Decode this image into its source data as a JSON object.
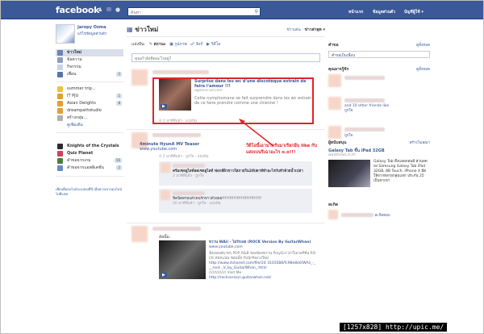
{
  "topbar": {
    "logo": "facebook",
    "search_placeholder": "ค้นหา",
    "home": "หน้าแรก",
    "profile": "ข้อมูลส่วนตัว",
    "account": "บัญชีผู้ใช้ ▾"
  },
  "profile": {
    "name": "Jaropy Ozma",
    "edit": "แก้ไขข้อมูลส่วนตัว"
  },
  "sidebar": {
    "items": [
      {
        "label": "ข่าวใหม่",
        "count": ""
      },
      {
        "label": "ข้อความ",
        "count": ""
      },
      {
        "label": "กิจกรรม",
        "count": ""
      },
      {
        "label": "เพื่อน",
        "count": "2"
      }
    ],
    "apps": [
      {
        "label": "summer trip...",
        "count": ""
      },
      {
        "label": "IT PJU",
        "count": "1"
      },
      {
        "label": "Asian Delights",
        "count": "8"
      },
      {
        "label": "dreampathstudio",
        "count": ""
      },
      {
        "label": "สร้างกลุ่ม...",
        "count": ""
      },
      {
        "label": "ดูเพิ่มเติม",
        "count": ""
      }
    ],
    "games": [
      {
        "label": "Knights of the Crystals",
        "count": ""
      },
      {
        "label": "Quiz Planet",
        "count": ""
      },
      {
        "label": "คำขอจากเกม",
        "count": "56"
      },
      {
        "label": "คำขอจากแอพลิเคชั่น",
        "count": "2"
      }
    ],
    "note": "เพื่อนที่ออนไลน์จะแสดงที่นี่ เมื่อพวกเขาออนไลน์ ไปที่แชท"
  },
  "feed": {
    "title": "ข่าวใหม่",
    "sort_top": "ข่าวเด่น",
    "sort_recent": "ข่าวล่าสุด ▾",
    "share_label": "แบ่งปัน:",
    "share_status": "สถานะ",
    "share_photo": "รูปภาพ",
    "share_link": "ลิงก์",
    "share_video": "วิดีโอ",
    "status_placeholder": "คุณกำลังคิดอะไรอยู่?",
    "post1": {
      "link_title": "Surprise dans les wc d'une discotèque estrain de faire l'amour !!!",
      "domain": "agence-ad.com",
      "desc": "Cette nymphomane se fait surprendre dans les wc estrain de ce faire prendre comme une chienne !",
      "meta": "2 นาทีที่แล้ว · แบ่งปัน"
    },
    "post2": {
      "title": "4minute HyunA MV Teaser",
      "domain": "www.youtube.com",
      "meta": "2 นาทีที่แล้ว · ถูกใจ · แบ่งปัน",
      "comment1": "ครีมเซลลูไลท์ลดเซลลูไลท์ ฟอกสีผิวขาวใสภายใน2สัปดาห์ทำอะไรกับทำด้วยน้ำเปล่า",
      "comment1_meta": "2 นาทีที่แล้ว · ถูกใจ",
      "comment2": "ฟิตนิตตรอบตัวคนรักข่าวด้วยยย!!!!!!!!!!!!!!!!!!!!!!!!!!!",
      "comment2_meta": "20 นาทีที่แล้ว · ถูกใจ · แบ่งปัน"
    },
    "post3": {
      "label": "อัลบั้ม:",
      "title": "หวาน WAii - ไม่รักเลย (ROCK Version By GuitarWhan)",
      "domain": "www.youtube.com",
      "desc": "ฟังเพลงสบายๆ POP R&B ของน้องหวาน PlayGirl มาในเวอร์ชั่น ROCK หนักแน่น ชอบมั้ย กับนักร้องวงใหม่",
      "link1": "http://www.4shared.com/file/24 3103588/fc98e8e0/WAii_-___rock _V_by_GuitarWhan_.html",
      "slashes": "////////////// Visit Me",
      "link2": "http://rockversion.guitarwhan.net/"
    }
  },
  "right": {
    "requests": "คำขอ",
    "requests_link": "ดูทั้งหมด",
    "request_text": "คำขอเป็นเพื่อน",
    "suggest_title": "คุณอาจรู้จัก",
    "suggest_link": "ดูทั้งหมด",
    "add_friend": "เพิ่มเป็นเพื่อน",
    "and_others": "and 10 other friends like",
    "like": "ถูกใจ",
    "sponsored": "ผู้สนับสนุน",
    "sponsored_link": "สร้างโฆษณา",
    "ad_title": "Galaxy Tab ขึ้น iPad 32GB",
    "ad_domain": "wallstreet.in.th",
    "ad_text": "Galaxy Tab ดึงแอพถอนมี ส่วนลดลง Samsung Galaxy Tab iPad 32GB, 8B Touch, iPhone 4 มีดให้จากหลายกลุ่มแจก ประกัน 25 เป็นขาเขา",
    "chat": "สะกิด",
    "chat_link": "สะกิดตอบ"
  },
  "annotation": {
    "text": "วีดีโอนี้เอามากรับมาเรียกอีบ like กับ แสงเบนรีเฉาอะไร o.o!!!"
  },
  "watermark": "[1257x828] http://upic.me/"
}
